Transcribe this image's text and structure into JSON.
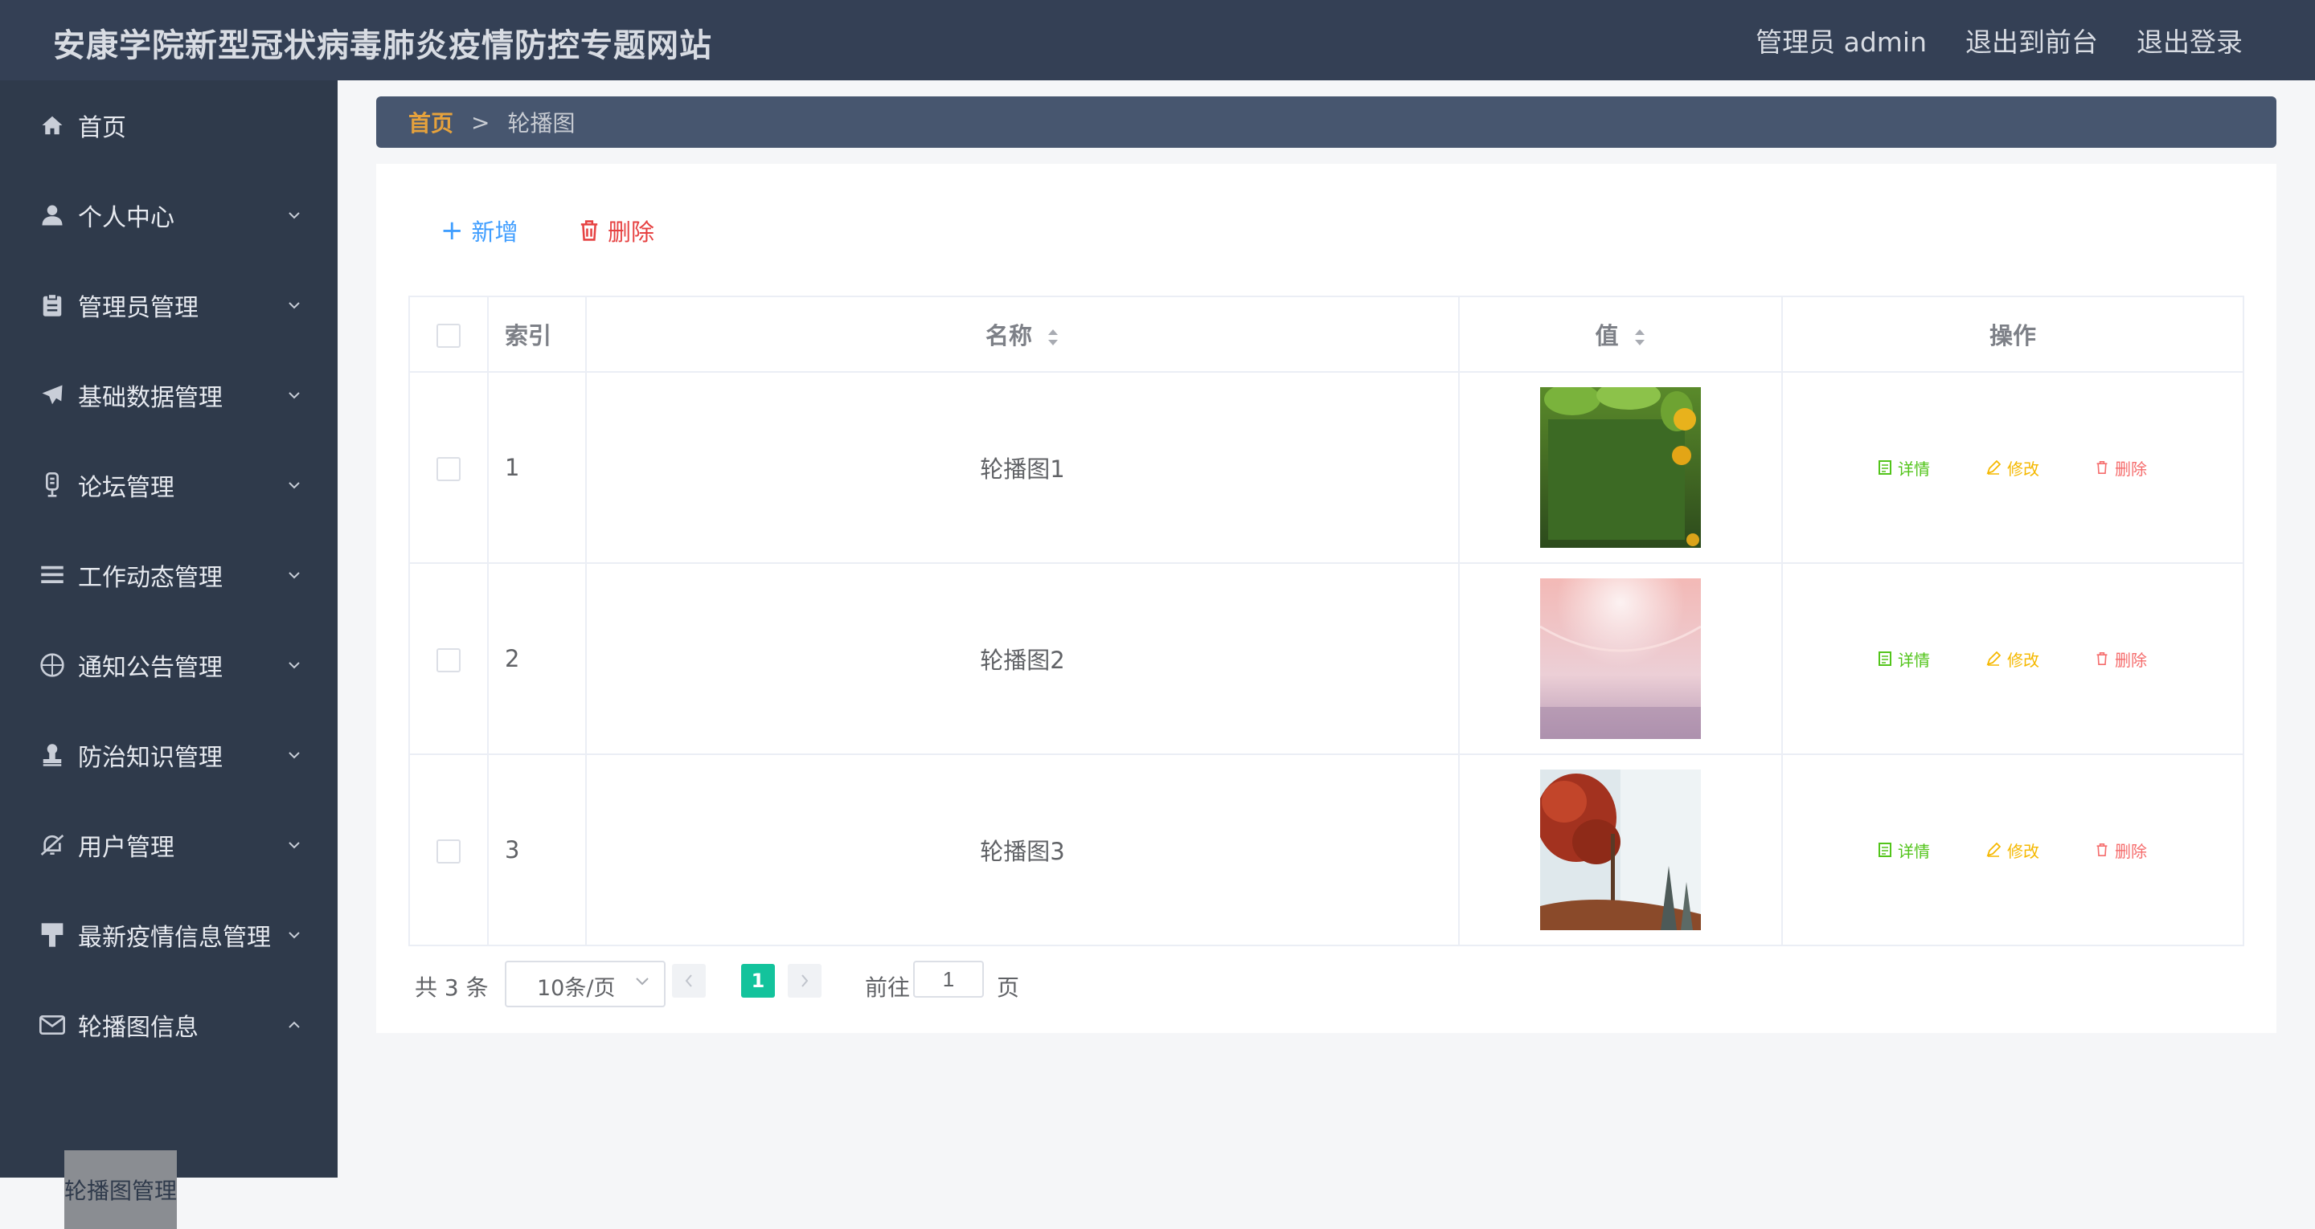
{
  "header": {
    "title": "安康学院新型冠状病毒肺炎疫情防控专题网站",
    "admin": "管理员 admin",
    "exit_front": "退出到前台",
    "logout": "退出登录"
  },
  "sidebar": {
    "items": [
      {
        "label": "首页",
        "icon": "home-icon"
      },
      {
        "label": "个人中心",
        "icon": "user-icon"
      },
      {
        "label": "管理员管理",
        "icon": "clipboard-icon"
      },
      {
        "label": "基础数据管理",
        "icon": "paper-plane-icon"
      },
      {
        "label": "论坛管理",
        "icon": "microphone-icon"
      },
      {
        "label": "工作动态管理",
        "icon": "list-icon"
      },
      {
        "label": "通知公告管理",
        "icon": "compass-icon"
      },
      {
        "label": "防治知识管理",
        "icon": "stamp-icon"
      },
      {
        "label": "用户管理",
        "icon": "bell-off-icon"
      },
      {
        "label": "最新疫情信息管理",
        "icon": "brush-icon"
      },
      {
        "label": "轮播图信息",
        "icon": "mail-icon"
      }
    ],
    "sub_item": "轮播图管理"
  },
  "breadcrumb": {
    "home": "首页",
    "separator": ">",
    "current": "轮播图"
  },
  "toolbar": {
    "add": "新增",
    "delete": "删除"
  },
  "table": {
    "headers": {
      "index": "索引",
      "name": "名称",
      "value": "值",
      "actions": "操作"
    },
    "rows": [
      {
        "index": "1",
        "name": "轮播图1",
        "thumb": "green-leaves-sunflower"
      },
      {
        "index": "2",
        "name": "轮播图2",
        "thumb": "pink-blossom-bokeh"
      },
      {
        "index": "3",
        "name": "轮播图3",
        "thumb": "red-tree-winter-road"
      }
    ],
    "actions": {
      "detail": "详情",
      "edit": "修改",
      "remove": "删除"
    }
  },
  "pagination": {
    "total": "共 3 条",
    "page_size": "10条/页",
    "current_page": "1",
    "goto_label": "前往",
    "goto_value": "1",
    "page_unit": "页"
  },
  "colors": {
    "header_bg": "#344055",
    "sidebar_bg": "#2f3a4b",
    "breadcrumb_bg": "#47566f",
    "breadcrumb_home": "#e6a23c",
    "primary": "#409eff",
    "danger": "#e64242",
    "success": "#52c41a",
    "warning": "#f5b800",
    "page_active": "#13c39c"
  }
}
